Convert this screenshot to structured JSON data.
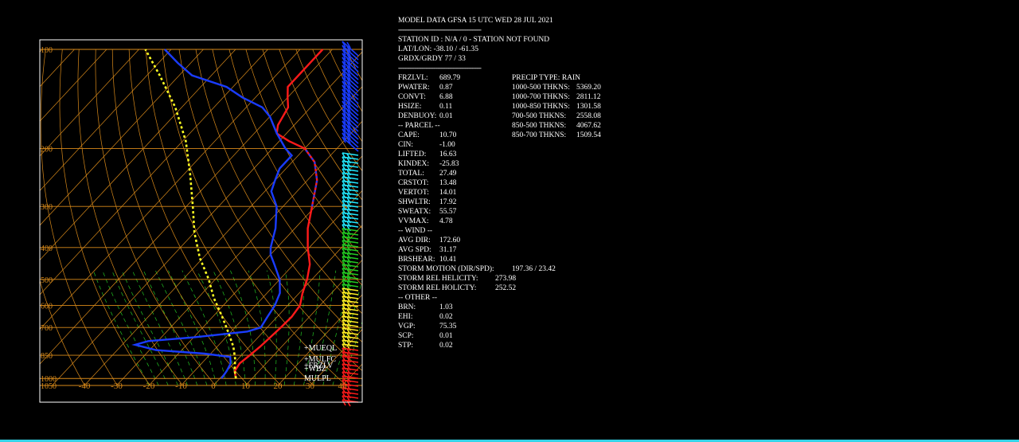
{
  "header": {
    "title": "MODEL DATA GFSA 15 UTC WED 28 JUL 2021",
    "rule": "------------------------------------------------"
  },
  "station": {
    "id_line": "STATION ID :  N/A  /    0  - STATION NOT FOUND",
    "latlon_line": "LAT/LON:    -38.10 /   -61.35",
    "grd_line": "GRDX/GRDY   77 /   33",
    "rule": "------------------------------------------------"
  },
  "params_left": [
    {
      "label": "FRZLVL:",
      "value": "689.79"
    },
    {
      "label": "PWATER:",
      "value": "0.87"
    },
    {
      "label": "CONVT:",
      "value": "6.88"
    },
    {
      "label": "HSIZE:",
      "value": "0.11"
    },
    {
      "label": "DENBUOY:",
      "value": "0.01"
    },
    {
      "label": "-- PARCEL --",
      "value": ""
    },
    {
      "label": "CAPE:",
      "value": "10.70"
    },
    {
      "label": "CIN:",
      "value": "-1.00"
    },
    {
      "label": "LIFTED:",
      "value": "16.63"
    },
    {
      "label": "KINDEX:",
      "value": "-25.83"
    },
    {
      "label": "TOTAL:",
      "value": "27.49"
    },
    {
      "label": "CRSTOT:",
      "value": "13.48"
    },
    {
      "label": "VERTOT:",
      "value": "14.01"
    },
    {
      "label": "SHWLTR:",
      "value": "17.92"
    },
    {
      "label": "SWEATX:",
      "value": "55.57"
    },
    {
      "label": "VVMAX:",
      "value": "4.78"
    },
    {
      "label": "-- WIND --",
      "value": ""
    },
    {
      "label": "AVG DIR:",
      "value": "172.60"
    },
    {
      "label": "AVG SPD:",
      "value": "31.17"
    },
    {
      "label": "BRSHEAR:",
      "value": "10.41"
    },
    {
      "label": "STORM MOTION (DIR/SPD):",
      "value": "197.36 /    23.42"
    },
    {
      "label": "STORM REL HELICITY:",
      "value": "273.98"
    },
    {
      "label": "STORM REL HOLICTY:",
      "value": "252.52"
    },
    {
      "label": "-- OTHER --",
      "value": ""
    },
    {
      "label": "BRN:",
      "value": "1.03"
    },
    {
      "label": "EHI:",
      "value": "0.02"
    },
    {
      "label": "VGP:",
      "value": "75.35"
    },
    {
      "label": "SCP:",
      "value": "0.01"
    },
    {
      "label": "STP:",
      "value": "0.02"
    }
  ],
  "params_right": [
    {
      "label": "PRECIP TYPE: RAIN",
      "value": ""
    },
    {
      "label": "1000-500 THKNS:",
      "value": "5369.20"
    },
    {
      "label": "1000-700 THKNS:",
      "value": "2811.12"
    },
    {
      "label": "1000-850 THKNS:",
      "value": "1301.58"
    },
    {
      "label": "700-500  THKNS:",
      "value": "2558.08"
    },
    {
      "label": "850-500  THKNS:",
      "value": "4067.62"
    },
    {
      "label": "850-700  THKNS:",
      "value": "1509.54"
    }
  ],
  "chart_data": {
    "type": "line",
    "xlim": [
      -50,
      45
    ],
    "ylim": [
      1050,
      100
    ],
    "y_scale": "log",
    "pressure_labels": [
      "100",
      "200",
      "300",
      "400",
      "500",
      "600",
      "700",
      "850",
      "1000",
      "1050"
    ],
    "pressure_values": [
      100,
      200,
      300,
      400,
      500,
      600,
      700,
      850,
      1000,
      1050
    ],
    "temp_labels": [
      "-40",
      "-30",
      "-20",
      "-10",
      "0",
      "10",
      "20",
      "30",
      "40"
    ],
    "temp_values": [
      -40,
      -30,
      -20,
      -10,
      0,
      10,
      20,
      30,
      40
    ],
    "colors": {
      "grid": "#d98a1a",
      "moist": "#22c322",
      "temperature": "#ff1a1a",
      "dewpoint": "#1a3cff",
      "parcel": "#ffff22",
      "overlap": "#ff2f9a",
      "frame": "#ffffff"
    },
    "series": [
      {
        "key": "temperature",
        "points": [
          [
            5,
            1000
          ],
          [
            2.5,
            950
          ],
          [
            1.8,
            900
          ],
          [
            2.6,
            850
          ],
          [
            3.3,
            800
          ],
          [
            4.2,
            700
          ],
          [
            4.5,
            650
          ],
          [
            3.8,
            600
          ],
          [
            1.0,
            550
          ],
          [
            -1.5,
            500
          ],
          [
            -5,
            450
          ],
          [
            -10.5,
            400
          ],
          [
            -16,
            350
          ],
          [
            -21,
            300
          ],
          [
            -27,
            250
          ],
          [
            -33,
            220
          ],
          [
            -40,
            200
          ],
          [
            -47,
            190
          ],
          [
            -53,
            180
          ],
          [
            -55,
            170
          ],
          [
            -57,
            150
          ],
          [
            -60,
            140
          ],
          [
            -63,
            130
          ],
          [
            -63,
            110
          ],
          [
            -63,
            100
          ]
        ]
      },
      {
        "key": "dewpoint",
        "points": [
          [
            0.5,
            1000
          ],
          [
            0,
            950
          ],
          [
            -1,
            900
          ],
          [
            -3,
            860
          ],
          [
            -12,
            840
          ],
          [
            -28,
            820
          ],
          [
            -36,
            790
          ],
          [
            -33,
            770
          ],
          [
            -20,
            750
          ],
          [
            -5,
            720
          ],
          [
            -2,
            700
          ],
          [
            -3,
            650
          ],
          [
            -4,
            600
          ],
          [
            -6,
            550
          ],
          [
            -10,
            500
          ],
          [
            -16,
            450
          ],
          [
            -20,
            420
          ],
          [
            -22,
            400
          ],
          [
            -26,
            350
          ],
          [
            -32,
            300
          ],
          [
            -38,
            270
          ],
          [
            -40,
            250
          ],
          [
            -42,
            230
          ],
          [
            -42,
            210
          ],
          [
            -46,
            200
          ],
          [
            -53,
            180
          ],
          [
            -60,
            160
          ],
          [
            -65,
            150
          ],
          [
            -74,
            140
          ],
          [
            -82,
            130
          ],
          [
            -96,
            120
          ],
          [
            -104,
            110
          ],
          [
            -112,
            100
          ]
        ]
      },
      {
        "key": "parcel",
        "points": [
          [
            5,
            1000
          ],
          [
            2.5,
            950
          ],
          [
            -1,
            870
          ],
          [
            -5,
            800
          ],
          [
            -11,
            720
          ],
          [
            -17,
            650
          ],
          [
            -25,
            570
          ],
          [
            -32,
            500
          ],
          [
            -41,
            430
          ],
          [
            -50,
            360
          ],
          [
            -58,
            300
          ],
          [
            -68,
            240
          ],
          [
            -79,
            190
          ],
          [
            -92,
            150
          ],
          [
            -106,
            120
          ],
          [
            -118,
            100
          ]
        ]
      }
    ],
    "parcel_labels": [
      "+MUEQL",
      "+MULFC",
      "+FRZLV",
      "+WBZ",
      "MULPL"
    ],
    "wind_barb_colors": [
      "blue",
      "cyan",
      "green",
      "yellow",
      "red"
    ]
  }
}
